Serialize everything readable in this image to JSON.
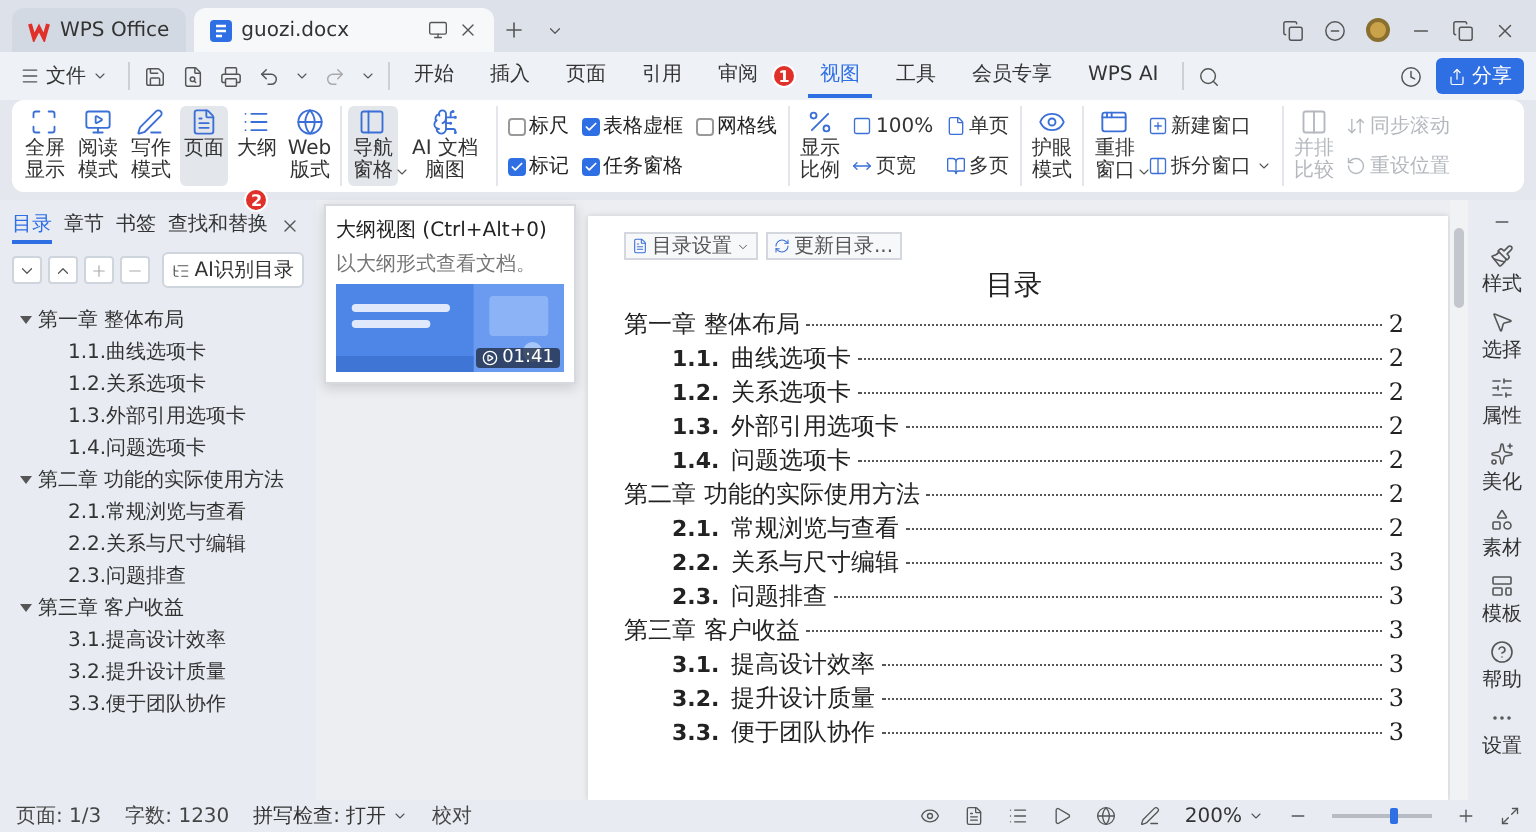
{
  "title_bar": {
    "tabs": [
      {
        "label": "WPS Office",
        "kind": "home",
        "selected": false
      },
      {
        "label": "guozi.docx",
        "kind": "doc",
        "selected": true
      }
    ]
  },
  "menu_bar": {
    "file": "文件",
    "tabs": [
      {
        "label": "开始",
        "selected": false
      },
      {
        "label": "插入",
        "selected": false
      },
      {
        "label": "页面",
        "selected": false
      },
      {
        "label": "引用",
        "selected": false
      },
      {
        "label": "审阅",
        "selected": false,
        "badge": "1"
      },
      {
        "label": "视图",
        "selected": true
      },
      {
        "label": "工具",
        "selected": false
      },
      {
        "label": "会员专享",
        "selected": false
      },
      {
        "label": "WPS AI",
        "selected": false
      }
    ],
    "share": "分享"
  },
  "ribbon": {
    "groups": [
      {
        "items": [
          {
            "kind": "big",
            "label": "全屏显示",
            "selected": false
          },
          {
            "kind": "big",
            "label": "阅读模式",
            "selected": false
          },
          {
            "kind": "big",
            "label": "写作模式",
            "selected": false
          },
          {
            "kind": "big",
            "label": "页面",
            "selected": true
          },
          {
            "kind": "big",
            "label": "大纲",
            "selected": false,
            "badge": "2"
          },
          {
            "kind": "big",
            "label": "Web版式",
            "selected": false
          }
        ]
      },
      {
        "items": [
          {
            "kind": "big",
            "label": "导航窗格",
            "selected": true,
            "dropdown": true
          },
          {
            "kind": "big",
            "label": "AI 文档脑图",
            "selected": false
          }
        ]
      },
      {
        "items": [
          {
            "kind": "check",
            "label": "标尺",
            "checked": false
          },
          {
            "kind": "check",
            "label": "标记",
            "checked": true
          },
          {
            "kind": "check",
            "label": "表格虚框",
            "checked": true
          },
          {
            "kind": "check",
            "label": "任务窗格",
            "checked": true
          },
          {
            "kind": "check",
            "label": "网格线",
            "checked": false
          }
        ]
      },
      {
        "items": [
          {
            "kind": "big",
            "label": "显示比例"
          },
          {
            "kind": "small",
            "label": "100%"
          },
          {
            "kind": "small",
            "label": "页宽"
          },
          {
            "kind": "small",
            "label": "单页"
          },
          {
            "kind": "small",
            "label": "多页"
          }
        ]
      },
      {
        "items": [
          {
            "kind": "big",
            "label": "护眼模式"
          }
        ]
      },
      {
        "items": [
          {
            "kind": "big",
            "label": "重排窗口",
            "dropdown": true
          },
          {
            "kind": "small",
            "label": "新建窗口"
          },
          {
            "kind": "small",
            "label": "拆分窗口",
            "dropdown": true
          }
        ]
      },
      {
        "items": [
          {
            "kind": "big",
            "label": "并排比较",
            "disabled": true
          },
          {
            "kind": "small",
            "label": "同步滚动",
            "disabled": true
          },
          {
            "kind": "small",
            "label": "重设位置",
            "disabled": true
          }
        ]
      }
    ]
  },
  "tooltip": {
    "title": "大纲视图 (Ctrl+Alt+0)",
    "description": "以大纲形式查看文档。",
    "duration": "01:41"
  },
  "nav_panel": {
    "tabs": [
      {
        "label": "目录",
        "selected": true
      },
      {
        "label": "章节",
        "selected": false
      },
      {
        "label": "书签",
        "selected": false
      },
      {
        "label": "查找和替换",
        "selected": false
      }
    ],
    "ai_button": "AI识别目录",
    "outline": [
      {
        "label": "第一章 整体布局",
        "expanded": true,
        "children": [
          {
            "label": "1.1.曲线选项卡"
          },
          {
            "label": "1.2.关系选项卡"
          },
          {
            "label": "1.3.外部引用选项卡"
          },
          {
            "label": "1.4.问题选项卡"
          }
        ]
      },
      {
        "label": "第二章 功能的实际使用方法",
        "expanded": true,
        "children": [
          {
            "label": "2.1.常规浏览与查看"
          },
          {
            "label": "2.2.关系与尺寸编辑"
          },
          {
            "label": "2.3.问题排查"
          }
        ]
      },
      {
        "label": "第三章 客户收益",
        "expanded": true,
        "children": [
          {
            "label": "3.1.提高设计效率"
          },
          {
            "label": "3.2.提升设计质量"
          },
          {
            "label": "3.3.便于团队协作"
          }
        ]
      }
    ]
  },
  "document": {
    "toolbar": [
      {
        "label": "目录设置",
        "dropdown": true
      },
      {
        "label": "更新目录..."
      }
    ],
    "toc": {
      "title": "目录",
      "chapters": [
        {
          "label": "第一章  整体布局",
          "page": "2",
          "sections": [
            {
              "number": "1.1.",
              "label": "曲线选项卡",
              "page": "2"
            },
            {
              "number": "1.2.",
              "label": "关系选项卡",
              "page": "2"
            },
            {
              "number": "1.3.",
              "label": "外部引用选项卡",
              "page": "2"
            },
            {
              "number": "1.4.",
              "label": "问题选项卡",
              "page": "2"
            }
          ]
        },
        {
          "label": "第二章  功能的实际使用方法",
          "page": "2",
          "sections": [
            {
              "number": "2.1.",
              "label": "常规浏览与查看",
              "page": "2"
            },
            {
              "number": "2.2.",
              "label": "关系与尺寸编辑",
              "page": "3"
            },
            {
              "number": "2.3.",
              "label": "问题排查",
              "page": "3"
            }
          ]
        },
        {
          "label": "第三章  客户收益",
          "page": "3",
          "sections": [
            {
              "number": "3.1.",
              "label": "提高设计效率",
              "page": "3"
            },
            {
              "number": "3.2.",
              "label": "提升设计质量",
              "page": "3"
            },
            {
              "number": "3.3.",
              "label": "便于团队协作",
              "page": "3"
            }
          ]
        }
      ]
    }
  },
  "right_sidebar": {
    "items": [
      {
        "label": "样式"
      },
      {
        "label": "选择"
      },
      {
        "label": "属性"
      },
      {
        "label": "美化"
      },
      {
        "label": "素材"
      },
      {
        "label": "模板"
      },
      {
        "label": "帮助"
      },
      {
        "label": "设置"
      }
    ]
  },
  "status_bar": {
    "page": "页面: 1/3",
    "words": "字数: 1230",
    "spell": "拼写检查: 打开",
    "proofread": "校对",
    "zoom": "200%",
    "zoom_slider": {
      "level": 0.62
    }
  }
}
